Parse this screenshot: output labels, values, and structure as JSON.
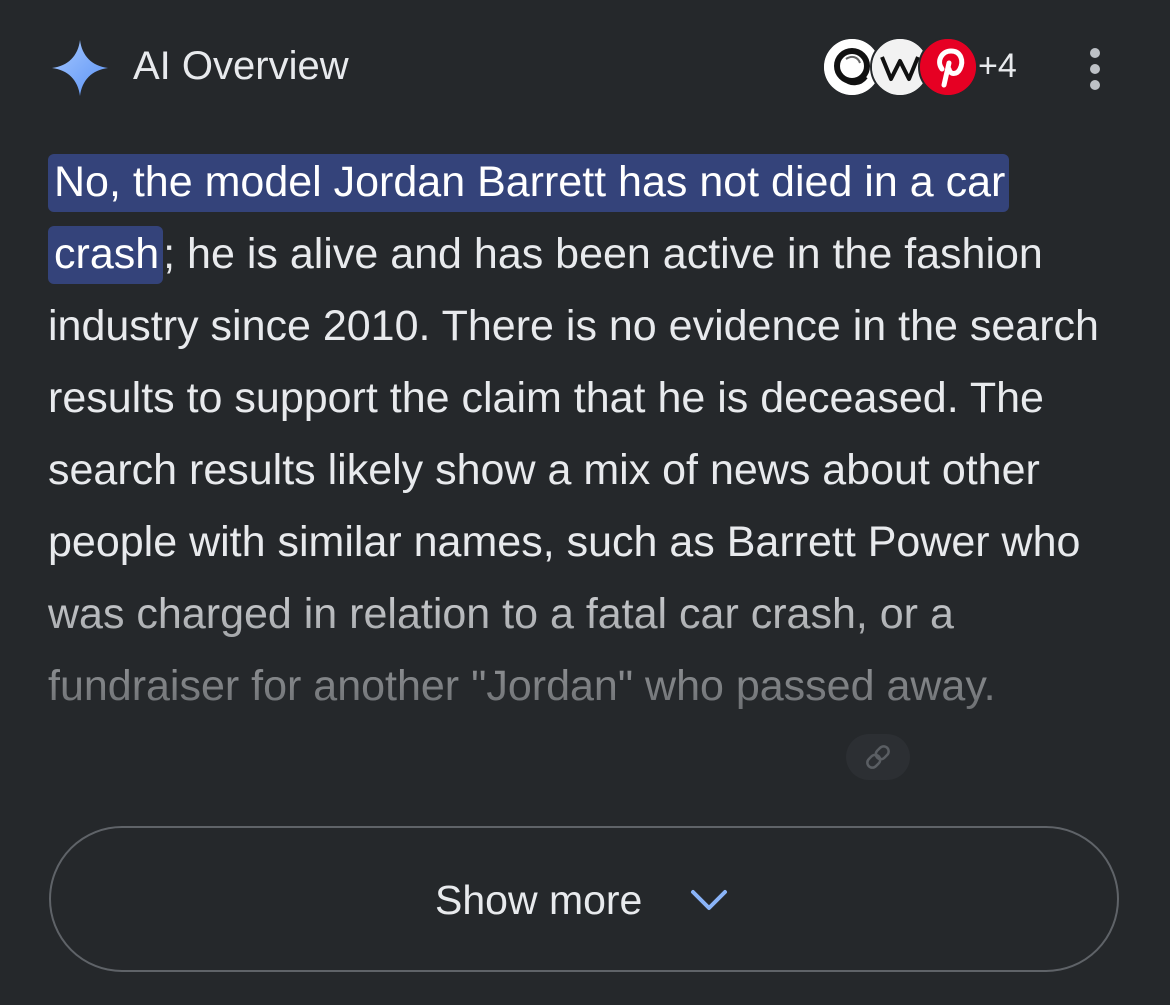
{
  "header": {
    "title": "AI Overview",
    "more_sources_count": "+4",
    "icons": {
      "spark": "sparkle-icon",
      "menu": "more-vertical-icon"
    }
  },
  "answer": {
    "highlighted": "No, the model Jordan Barrett has not died in a car crash",
    "rest": "; he is alive and has been active in the fashion industry since 2010. There is no evidence in the search results to support the claim that he is deceased. The search results likely show a mix of news about other people with similar names, such as Barrett Power who was charged in relation to a fatal car crash, or a fundraiser for another \"Jordan\" who passed away."
  },
  "show_more": {
    "label": "Show more"
  },
  "colors": {
    "background": "#25282b",
    "highlight": "#34437a",
    "accent_blue": "#8ab4f8",
    "text": "#e8eaed"
  }
}
